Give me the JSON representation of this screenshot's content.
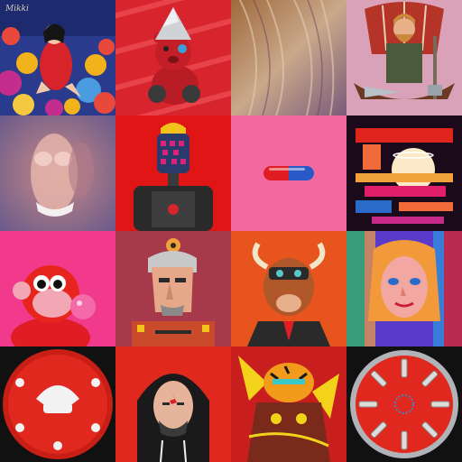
{
  "grid": {
    "columns": 4,
    "rows": 4,
    "tiles": [
      {
        "id": "woman-flowers",
        "signature": "Mikki"
      },
      {
        "id": "red-bear-foil-hat"
      },
      {
        "id": "abstract-brush-texture"
      },
      {
        "id": "viking-warrior"
      },
      {
        "id": "blurred-figure"
      },
      {
        "id": "robot-bust-dark"
      },
      {
        "id": "red-blue-pill"
      },
      {
        "id": "retro-sunset-glitch"
      },
      {
        "id": "monkey-bubblegum"
      },
      {
        "id": "gray-hair-face"
      },
      {
        "id": "bull-vr-goggles"
      },
      {
        "id": "psychedelic-portrait"
      },
      {
        "id": "red-sphere-pattern"
      },
      {
        "id": "bolt-hoodie-man"
      },
      {
        "id": "tiger-warrior"
      },
      {
        "id": "radial-screws-disc"
      }
    ]
  },
  "colors": {
    "primary_red": "#e0281e",
    "hot_pink": "#f23a8c",
    "dark_bg": "#111111"
  }
}
